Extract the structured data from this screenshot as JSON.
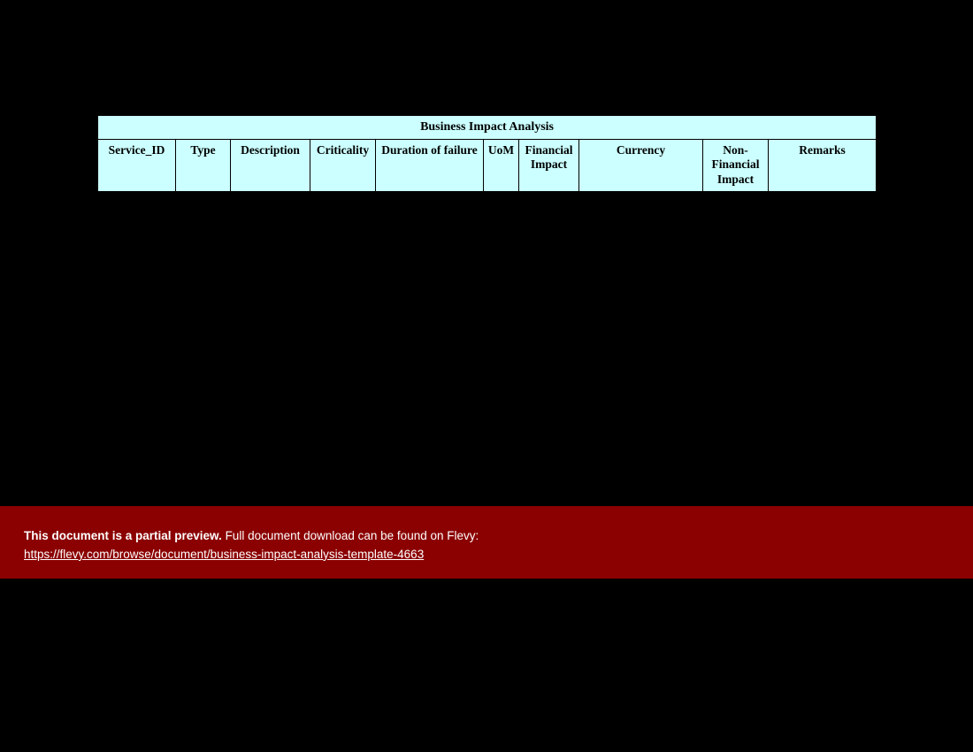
{
  "table": {
    "title": "Business Impact Analysis",
    "headers": [
      "Service_ID",
      "Type",
      "Description",
      "Criticality",
      "Duration of failure",
      "UoM",
      "Financial Impact",
      "Currency",
      "Non-Financial Impact",
      "Remarks"
    ]
  },
  "banner": {
    "bold": "This document is a partial preview.",
    "rest": "  Full document download can be found on Flevy:",
    "link_text": "https://flevy.com/browse/document/business-impact-analysis-template-4663",
    "link_href": "https://flevy.com/browse/document/business-impact-analysis-template-4663"
  }
}
